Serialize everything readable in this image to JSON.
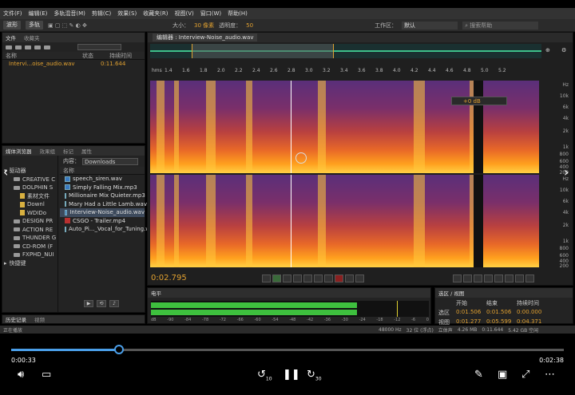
{
  "menu": [
    "文件(F)",
    "编辑(E)",
    "多轨混音(M)",
    "剪辑(C)",
    "效果(S)",
    "收藏夹(R)",
    "视图(V)",
    "窗口(W)",
    "帮助(H)"
  ],
  "toolbar": {
    "wave_label": "波形",
    "multi_label": "多轨",
    "size_label": "大小：",
    "size_value": "30 像素",
    "opacity_label": "透明度：",
    "opacity_value": "50",
    "workspace_label": "工作区：",
    "workspace_value": "默认",
    "search_placeholder": "搜索帮助"
  },
  "files_panel": {
    "tabs": [
      "文件",
      "收藏夹"
    ],
    "col_name": "名称",
    "col_status": "状态",
    "col_duration": "持续时间",
    "file_name": "Intervi...oise_audio.wav",
    "file_duration": "0:11.644"
  },
  "media_browser": {
    "tabs": [
      "媒体浏览器",
      "效果组",
      "标记",
      "属性"
    ],
    "content_label": "内容：",
    "content_value": "Downloads",
    "drives_label": "驱动器",
    "name_col": "名称",
    "tree": [
      "CREATIVE C",
      "DOLPHIN S",
      "素材文件",
      "Downl",
      "WDIDo",
      "DESIGN PR",
      "ACTION RE",
      "THUNDER G",
      "CD-ROM (F",
      "FXPHD_NUI"
    ],
    "shortcut_label": "快捷键",
    "files": [
      "speech_siren.wav",
      "Simply Falling Mix.mp3",
      "Millionaire Mix Quieter.mp3",
      "Mary Had a Little Lamb.wav",
      "Interview-Noise_audio.wav",
      "CSGO - Trailer.mp4",
      "Auto_Pi..._Vocal_for_Tuning.wa"
    ]
  },
  "editor": {
    "tab": "编辑器 : Interview-Noise_audio.wav",
    "ruler": [
      "hms",
      "1.4",
      "1.6",
      "1.8",
      "2.0",
      "2.2",
      "2.4",
      "2.6",
      "2.8",
      "3.0",
      "3.2",
      "3.4",
      "3.6",
      "3.8",
      "4.0",
      "4.2",
      "4.4",
      "4.6",
      "4.8",
      "5.0",
      "5.2"
    ],
    "hz_labels": [
      "Hz",
      "10k",
      "6k",
      "4k",
      "2k",
      "1k",
      "800",
      "600",
      "400",
      "200"
    ],
    "gain_value": "+0 dB",
    "timecode": "0:02.795"
  },
  "meter": {
    "label": "电平",
    "scale": [
      "dB",
      "-90",
      "-84",
      "-78",
      "-72",
      "-66",
      "-60",
      "-54",
      "-48",
      "-42",
      "-36",
      "-30",
      "-24",
      "-18",
      "-12",
      "-6",
      "0"
    ]
  },
  "selection": {
    "title": "选区 / 视图",
    "headers": [
      "开始",
      "结束",
      "持续时间"
    ],
    "rows": [
      {
        "name": "选区",
        "start": "0:01.506",
        "end": "0:01.506",
        "dur": "0:00.000"
      },
      {
        "name": "视图",
        "start": "0:01.277",
        "end": "0:05.599",
        "dur": "0:04.371"
      }
    ]
  },
  "history_tabs": [
    "历史记录",
    "视频"
  ],
  "statusbar": {
    "left": "正在播放",
    "info": [
      "48000 Hz",
      "32 位 (浮点)",
      "立体声",
      "4.26 MB",
      "0:11.644",
      "5.42 GB 空闲"
    ]
  },
  "player": {
    "current": "0:00:33",
    "total": "0:02:38",
    "progress": 0.195,
    "skip_back": "10",
    "skip_fwd": "30"
  }
}
